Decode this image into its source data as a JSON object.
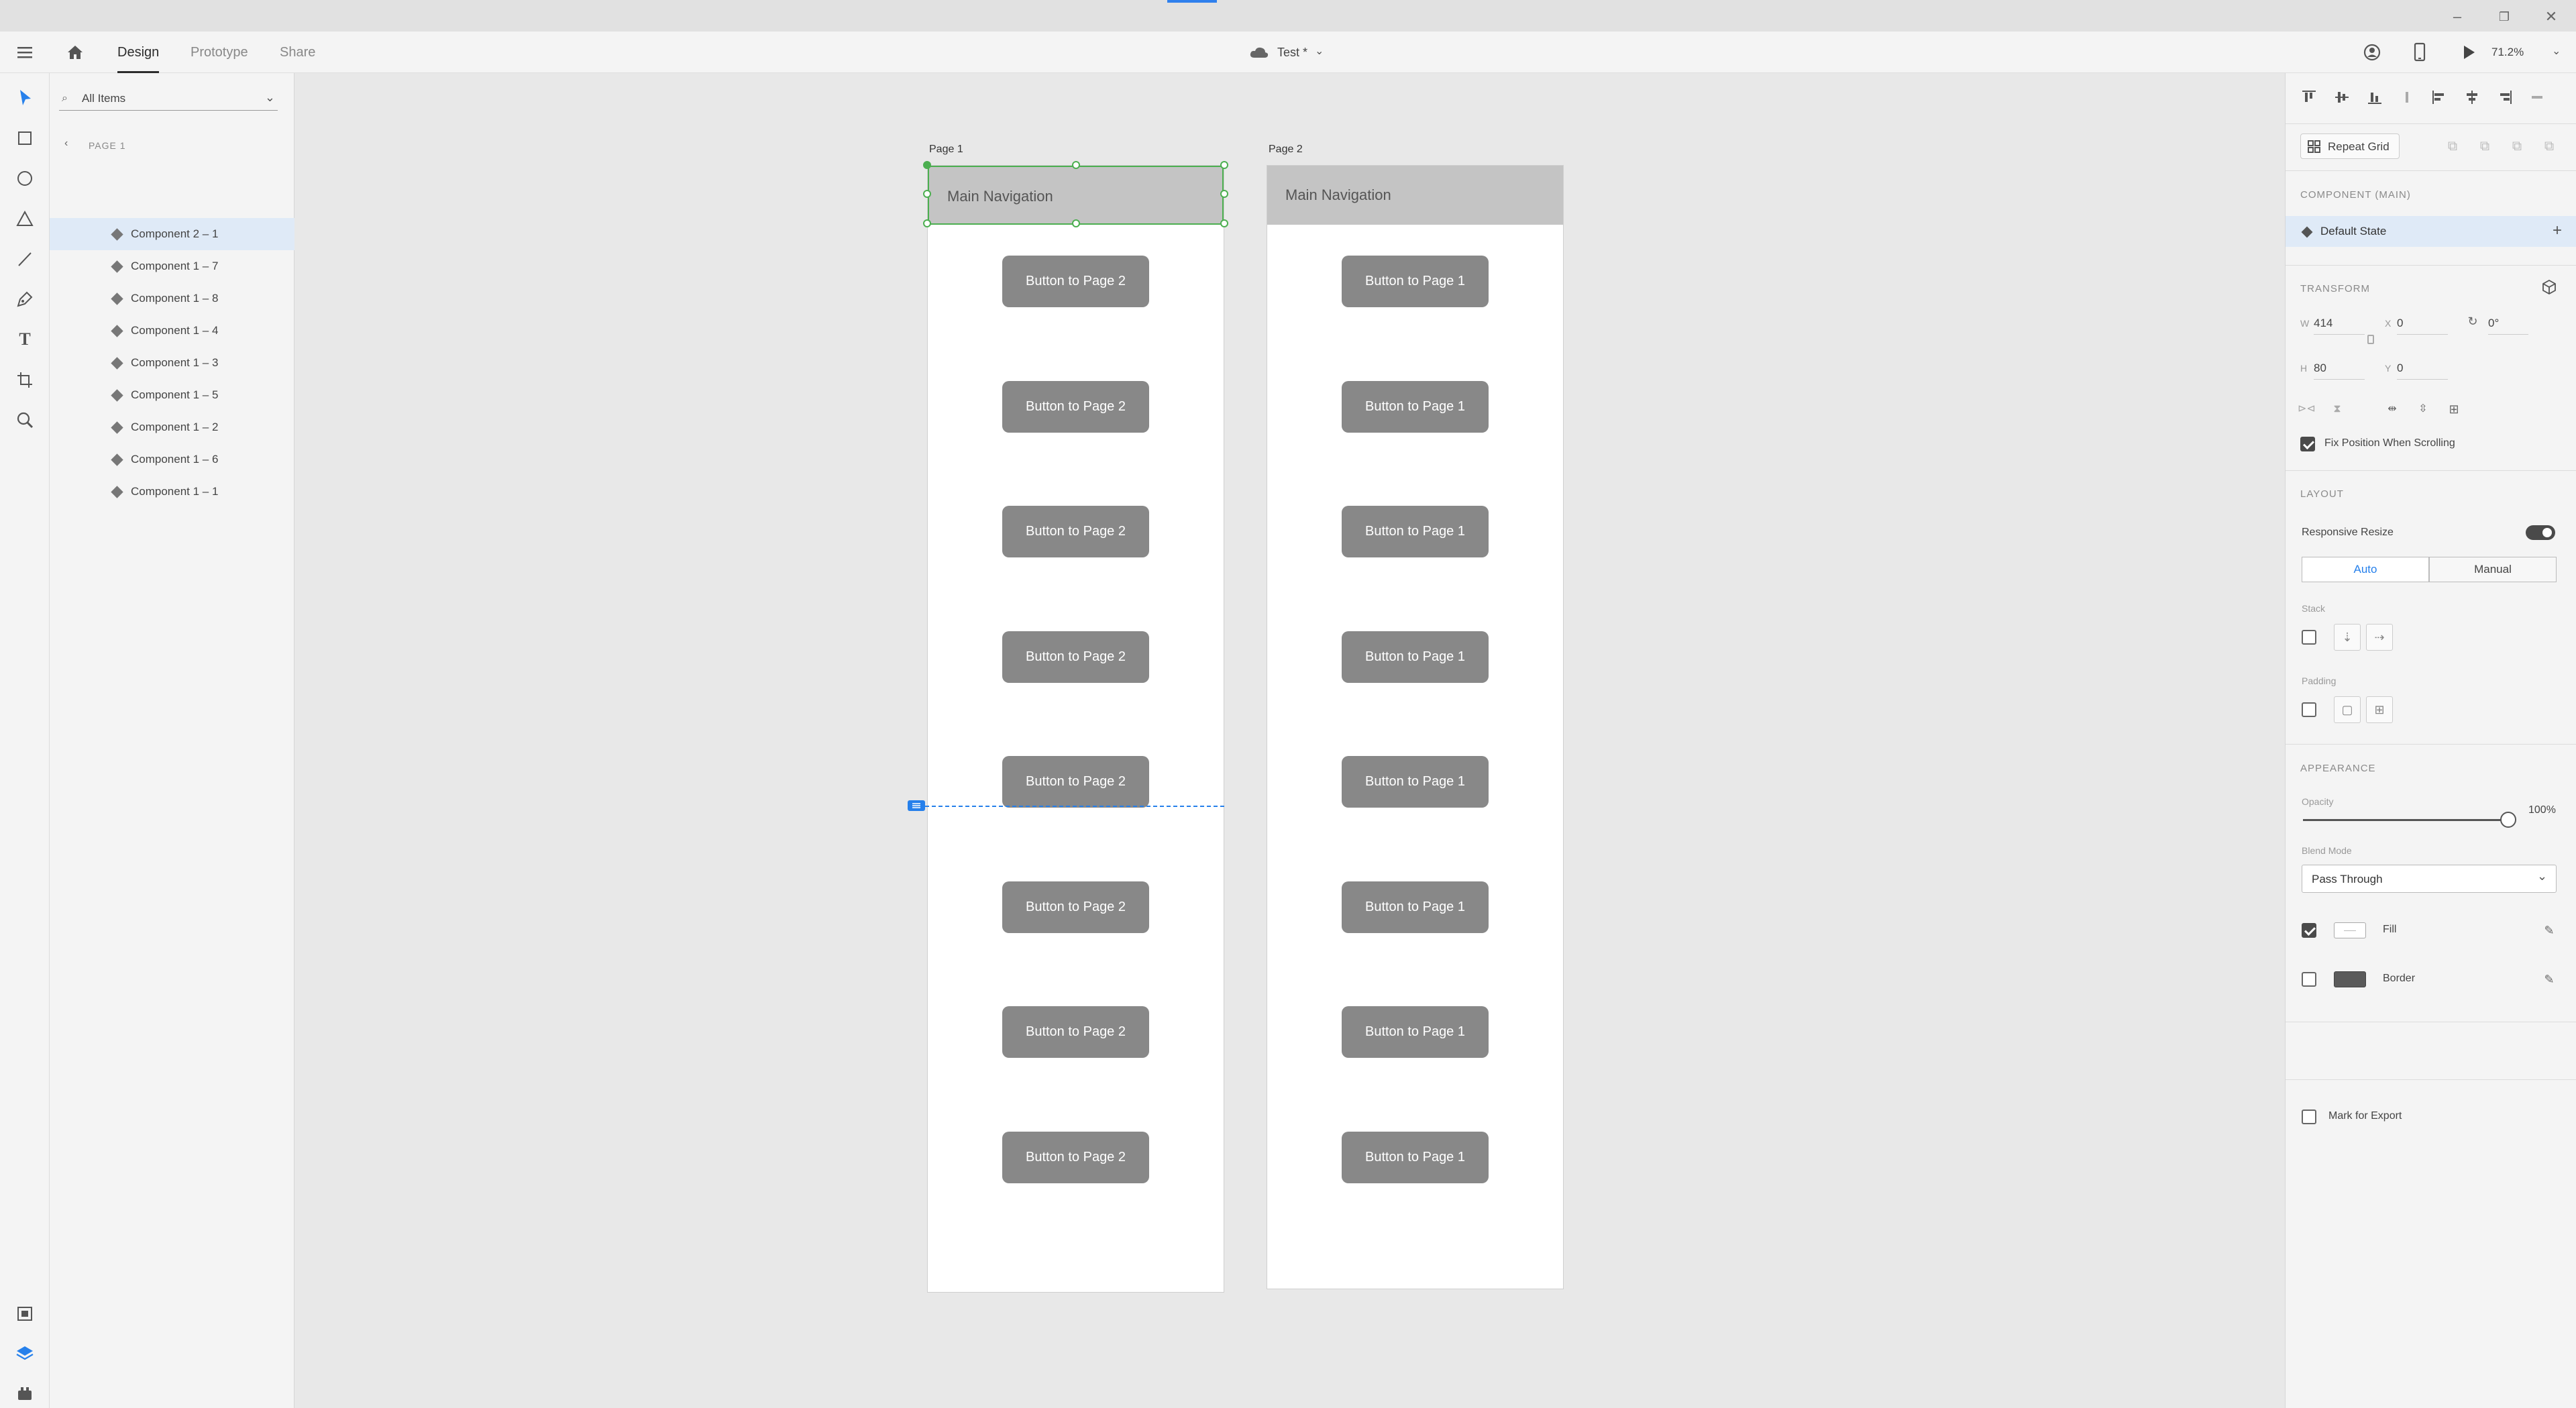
{
  "menubar": {
    "tabs": [
      {
        "label": "Design"
      },
      {
        "label": "Prototype"
      },
      {
        "label": "Share"
      }
    ],
    "document_title": "Test *",
    "zoom": "71.2%"
  },
  "layers": {
    "search_placeholder": "All Items",
    "page_label": "PAGE 1",
    "items": [
      {
        "label": "Component 2 – 1"
      },
      {
        "label": "Component 1 – 7"
      },
      {
        "label": "Component 1 – 8"
      },
      {
        "label": "Component 1 – 4"
      },
      {
        "label": "Component 1 – 3"
      },
      {
        "label": "Component 1 – 5"
      },
      {
        "label": "Component 1 – 2"
      },
      {
        "label": "Component 1 – 6"
      },
      {
        "label": "Component 1 – 1"
      }
    ]
  },
  "canvas": {
    "artboards": [
      {
        "title": "Page 1",
        "nav": "Main Navigation",
        "buttons": [
          "Button to Page 2",
          "Button to Page 2",
          "Button to Page 2",
          "Button to Page 2",
          "Button to Page 2",
          "Button to Page 2",
          "Button to Page 2",
          "Button to Page 2"
        ]
      },
      {
        "title": "Page 2",
        "nav": "Main Navigation",
        "buttons": [
          "Button to Page 1",
          "Button to Page 1",
          "Button to Page 1",
          "Button to Page 1",
          "Button to Page 1",
          "Button to Page 1",
          "Button to Page 1",
          "Button to Page 1"
        ]
      }
    ],
    "selection_color": "#4caf50"
  },
  "props": {
    "repeat_grid": "Repeat Grid",
    "component_heading": "COMPONENT (MAIN)",
    "default_state": "Default State",
    "transform_heading": "TRANSFORM",
    "w_label": "W",
    "w": "414",
    "h_label": "H",
    "h": "80",
    "x_label": "X",
    "x": "0",
    "y_label": "Y",
    "y": "0",
    "rotation": "0°",
    "fix_position": "Fix Position When Scrolling",
    "layout_heading": "LAYOUT",
    "responsive_resize": "Responsive Resize",
    "auto": "Auto",
    "manual": "Manual",
    "stack": "Stack",
    "padding": "Padding",
    "appearance_heading": "APPEARANCE",
    "opacity_label": "Opacity",
    "opacity": "100%",
    "blend_mode_label": "Blend Mode",
    "blend_mode": "Pass Through",
    "fill": "Fill",
    "border": "Border",
    "mark_export": "Mark for Export"
  }
}
